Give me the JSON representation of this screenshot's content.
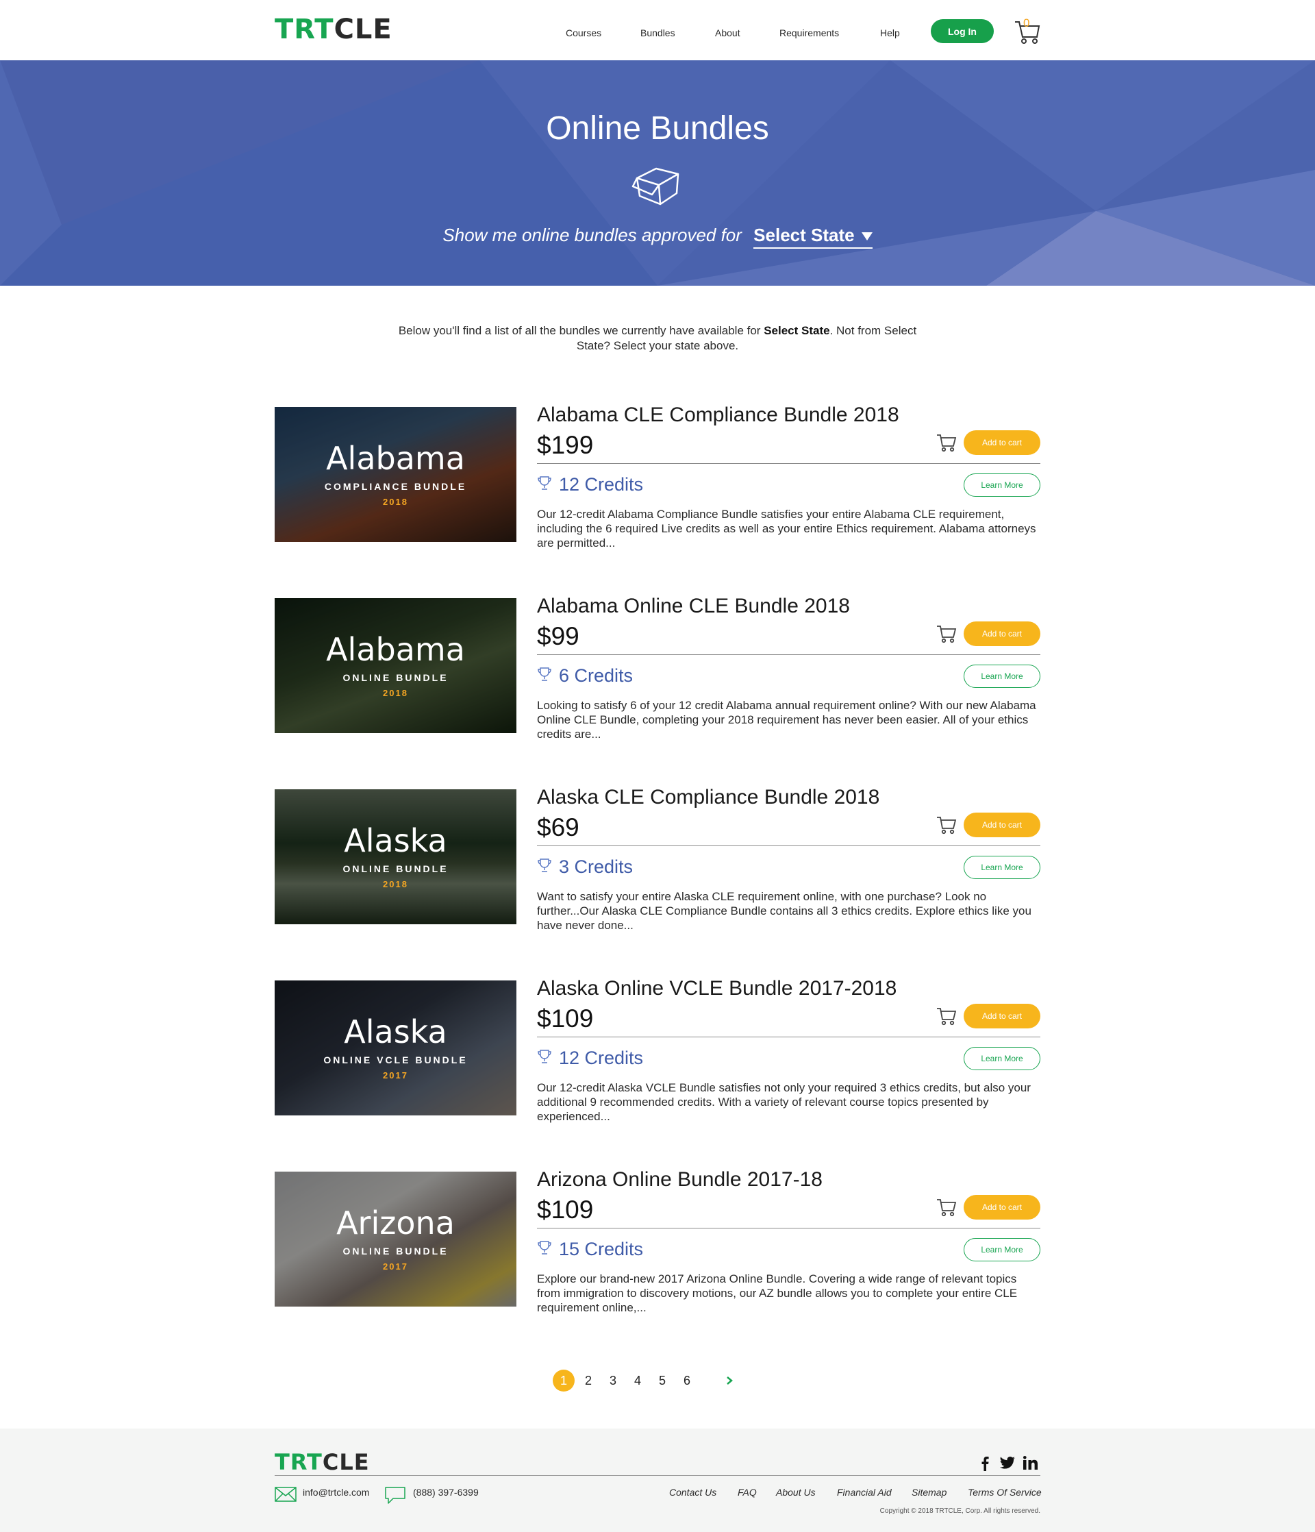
{
  "header": {
    "logo_part1": "TRT",
    "logo_part2": "CLE",
    "nav": [
      "Courses",
      "Bundles",
      "About",
      "Requirements",
      "Help"
    ],
    "login_label": "Log In",
    "cart_count": "0"
  },
  "hero": {
    "title": "Online Bundles",
    "lead": "Show me online bundles approved for",
    "state_select": "Select State"
  },
  "intro": {
    "part1": "Below you'll find a list of all the bundles we currently have available for ",
    "state": "Select State",
    "part2": ". Not from Select State? Select your state above."
  },
  "bundles": [
    {
      "title": "Alabama CLE Compliance Bundle 2018",
      "price": "$199",
      "credits": "12 Credits",
      "add_label": "Add to cart",
      "learn_label": "Learn More",
      "desc": "Our 12-credit Alabama Compliance Bundle satisfies your entire Alabama CLE requirement, including the 6 required Live credits as well as your entire Ethics requirement.  Alabama attorneys are permitted...",
      "thumb_state": "Alabama",
      "thumb_sub": "COMPLIANCE BUNDLE",
      "thumb_year": "2018"
    },
    {
      "title": "Alabama Online CLE Bundle 2018",
      "price": "$99",
      "credits": "6 Credits",
      "add_label": "Add to cart",
      "learn_label": "Learn More",
      "desc": "Looking to satisfy 6 of your 12 credit Alabama annual requirement online? With our new Alabama Online CLE Bundle, completing your 2018 requirement has never been easier. All of your ethics credits are...",
      "thumb_state": "Alabama",
      "thumb_sub": "ONLINE BUNDLE",
      "thumb_year": "2018"
    },
    {
      "title": "Alaska CLE Compliance Bundle 2018",
      "price": "$69",
      "credits": "3 Credits",
      "add_label": "Add to cart",
      "learn_label": "Learn More",
      "desc": "Want to satisfy your entire Alaska CLE requirement online, with one purchase? Look no further...Our Alaska CLE Compliance Bundle contains all 3 ethics credits. Explore ethics like you have never done...",
      "thumb_state": "Alaska",
      "thumb_sub": "ONLINE BUNDLE",
      "thumb_year": "2018"
    },
    {
      "title": "Alaska Online VCLE Bundle 2017-2018",
      "price": "$109",
      "credits": "12 Credits",
      "add_label": "Add to cart",
      "learn_label": "Learn More",
      "desc": "Our 12-credit Alaska VCLE Bundle satisfies not only your required 3 ethics credits, but also your additional 9 recommended credits. With a variety of relevant course topics presented by experienced...",
      "thumb_state": "Alaska",
      "thumb_sub": "ONLINE VCLE BUNDLE",
      "thumb_year": "2017"
    },
    {
      "title": "Arizona Online Bundle 2017-18",
      "price": "$109",
      "credits": "15 Credits",
      "add_label": "Add to cart",
      "learn_label": "Learn More",
      "desc": "Explore our brand-new 2017 Arizona Online Bundle. Covering a wide range of relevant topics from immigration to discovery motions, our AZ bundle allows you to complete your entire CLE requirement online,...",
      "thumb_state": "Arizona",
      "thumb_sub": "ONLINE BUNDLE",
      "thumb_year": "2017"
    }
  ],
  "pagination": {
    "pages": [
      "1",
      "2",
      "3",
      "4",
      "5",
      "6"
    ],
    "current": "1"
  },
  "footer": {
    "logo_part1": "TRT",
    "logo_part2": "CLE",
    "email": "info@trtcle.com",
    "phone": "(888) 397-6399",
    "links": [
      "Contact Us",
      "FAQ",
      "About Us",
      "Financial Aid",
      "Sitemap",
      "Terms Of Service"
    ],
    "copyright": "Copyright © 2018 TRTCLE, Corp. All rights reserved."
  },
  "colors": {
    "brand_green": "#18a551",
    "accent_orange": "#f7b51c",
    "hero_blue": "#4b63ae",
    "credits_blue": "#3f5ba8"
  }
}
